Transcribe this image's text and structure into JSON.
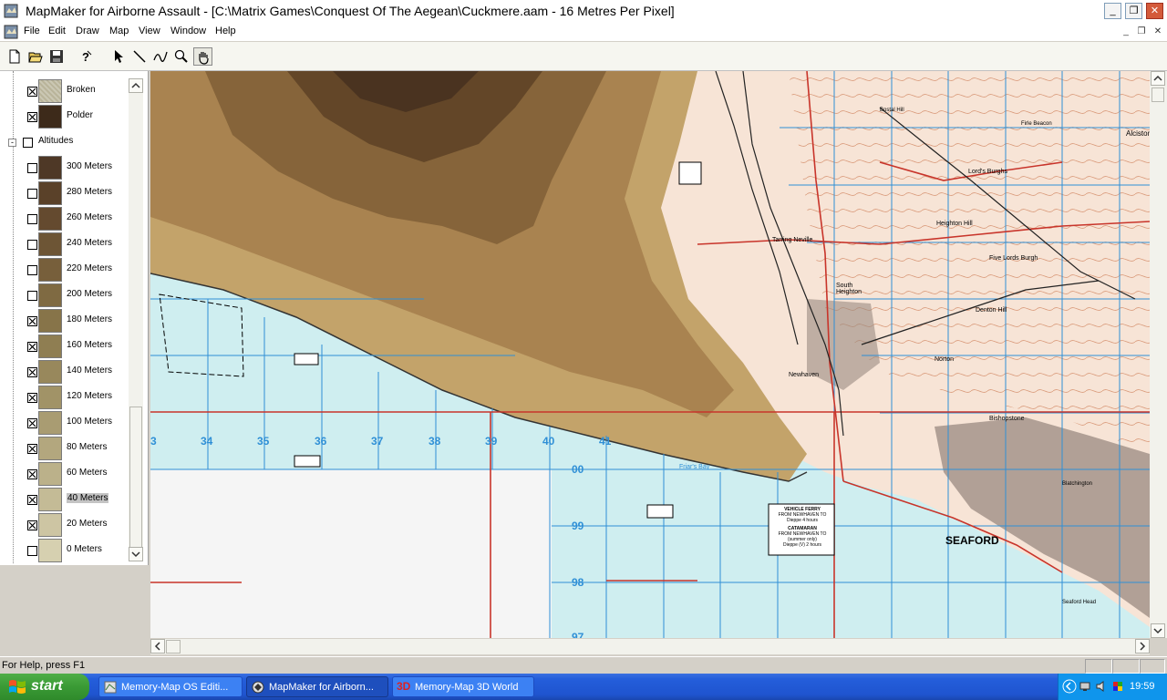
{
  "window": {
    "title": "MapMaker for Airborne Assault - [C:\\Matrix Games\\Conquest Of The Aegean\\Cuckmere.aam - 16 Metres Per Pixel]",
    "min_label": "_",
    "max_label": "❐",
    "close_label": "✕"
  },
  "menu": {
    "items": [
      "File",
      "Edit",
      "Draw",
      "Map",
      "View",
      "Window",
      "Help"
    ]
  },
  "toolbar": {
    "tools": [
      "new-icon",
      "open-icon",
      "save-icon",
      "help-icon",
      "select-arrow-icon",
      "line-icon",
      "freehand-icon",
      "zoom-icon",
      "hand-pan-icon"
    ]
  },
  "tree": {
    "items": [
      {
        "label": "Broken",
        "checked": true,
        "color": "#b9b49a",
        "textured": true
      },
      {
        "label": "Polder",
        "checked": true,
        "color": "#3d2a1a",
        "textured": false
      },
      {
        "label": "Altitudes",
        "checked": false,
        "group": true
      },
      {
        "label": "300 Meters",
        "checked": false,
        "color": "#4e3826"
      },
      {
        "label": "280 Meters",
        "checked": false,
        "color": "#5a4129"
      },
      {
        "label": "260 Meters",
        "checked": false,
        "color": "#644a2f"
      },
      {
        "label": "240 Meters",
        "checked": false,
        "color": "#6d5535"
      },
      {
        "label": "220 Meters",
        "checked": false,
        "color": "#775f3b"
      },
      {
        "label": "200 Meters",
        "checked": false,
        "color": "#7f6a42"
      },
      {
        "label": "180 Meters",
        "checked": true,
        "color": "#877449"
      },
      {
        "label": "160 Meters",
        "checked": true,
        "color": "#8f7e52"
      },
      {
        "label": "140 Meters",
        "checked": true,
        "color": "#98885c"
      },
      {
        "label": "120 Meters",
        "checked": true,
        "color": "#a19367"
      },
      {
        "label": "100 Meters",
        "checked": true,
        "color": "#a99c72"
      },
      {
        "label": "80 Meters",
        "checked": true,
        "color": "#b3a77e"
      },
      {
        "label": "60 Meters",
        "checked": true,
        "color": "#bbb18a"
      },
      {
        "label": "40 Meters",
        "checked": true,
        "color": "#c4bb96",
        "selected": true
      },
      {
        "label": "20 Meters",
        "checked": true,
        "color": "#cdc5a3"
      },
      {
        "label": "0 Meters",
        "checked": false,
        "color": "#d6d0b0"
      }
    ]
  },
  "map": {
    "grid_numbers_x": [
      "3",
      "34",
      "35",
      "36",
      "37",
      "38",
      "39",
      "40",
      "41"
    ],
    "grid_numbers_y": [
      "00",
      "99",
      "98",
      "97"
    ],
    "place_names": [
      "SEAFORD",
      "South Heighton",
      "Friar's Bay",
      "Bishopstone",
      "Norton",
      "Denton Hill",
      "Five Lords Burgh",
      "Heighton Hill",
      "Tarring Neville",
      "Lord's Burghs",
      "Alciston",
      "Seaford Head",
      "Blatchington",
      "Newhaven",
      "Firle Beacon",
      "Bostal Hill"
    ],
    "ferry_notice": [
      "VEHICLE FERRY",
      "FROM NEWHAVEN TO",
      "Dieppe    4 hours",
      "CATAMARAN",
      "FROM NEWHAVEN TO",
      "(summer only)",
      "Dieppe (V)    2 hours"
    ],
    "colors": {
      "sea": "#cfeef0",
      "grid": "#2f8fd6",
      "road": "#c8342a",
      "land_light": "#f7e0d0",
      "contour": "#d79a7a"
    }
  },
  "status": {
    "help_text": "For Help, press F1"
  },
  "taskbar": {
    "start_label": "start",
    "tasks": [
      {
        "label": "Memory-Map OS Editi...",
        "active": false
      },
      {
        "label": "MapMaker for Airborn...",
        "active": true
      },
      {
        "label": "Memory-Map 3D World",
        "active": false
      }
    ],
    "clock": "19:59"
  }
}
